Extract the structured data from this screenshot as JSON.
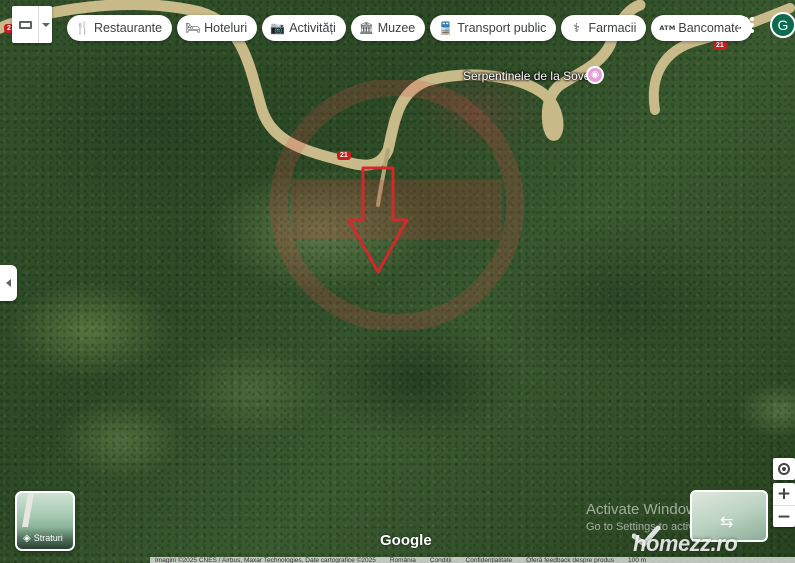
{
  "toolbar": {
    "keyboard_icon": "keyboard-icon",
    "dropdown_icon": "chevron-down-icon"
  },
  "chips": [
    {
      "label": "Restaurante",
      "icon": "🍴",
      "icon_name": "restaurant-icon"
    },
    {
      "label": "Hoteluri",
      "icon": "🛏",
      "icon_name": "hotel-icon"
    },
    {
      "label": "Activități",
      "icon": "📷",
      "icon_name": "camera-icon"
    },
    {
      "label": "Muzee",
      "icon": "🏛",
      "icon_name": "museum-icon"
    },
    {
      "label": "Transport public",
      "icon": "🚆",
      "icon_name": "transit-icon"
    },
    {
      "label": "Farmacii",
      "icon": "⚕",
      "icon_name": "pharmacy-icon"
    },
    {
      "label": "Bancomate",
      "icon": "ATM",
      "icon_name": "atm-icon"
    }
  ],
  "account": {
    "initial": "G"
  },
  "map": {
    "place_label": "Serpentinele de la Soveja",
    "route_labels": [
      "21",
      "21",
      "2"
    ],
    "layers_label": "Straturi",
    "google_logo": "Google",
    "colors": {
      "road": "#cdbd8a",
      "marker": "#d4262b"
    }
  },
  "system": {
    "activate_title": "Activate Windows",
    "activate_subtitle": "Go to Settings to activate Windows."
  },
  "brand_watermark": "homezz.ro",
  "attribution": [
    "Imagini ©2025 CNES / Airbus, Maxar Technologies, Date cartografice ©2025",
    "România",
    "Condiții",
    "Confidențialitate",
    "Oferă feedback despre produs",
    "100 m"
  ],
  "controls": {
    "zoom_in": "+",
    "zoom_out": "−"
  }
}
